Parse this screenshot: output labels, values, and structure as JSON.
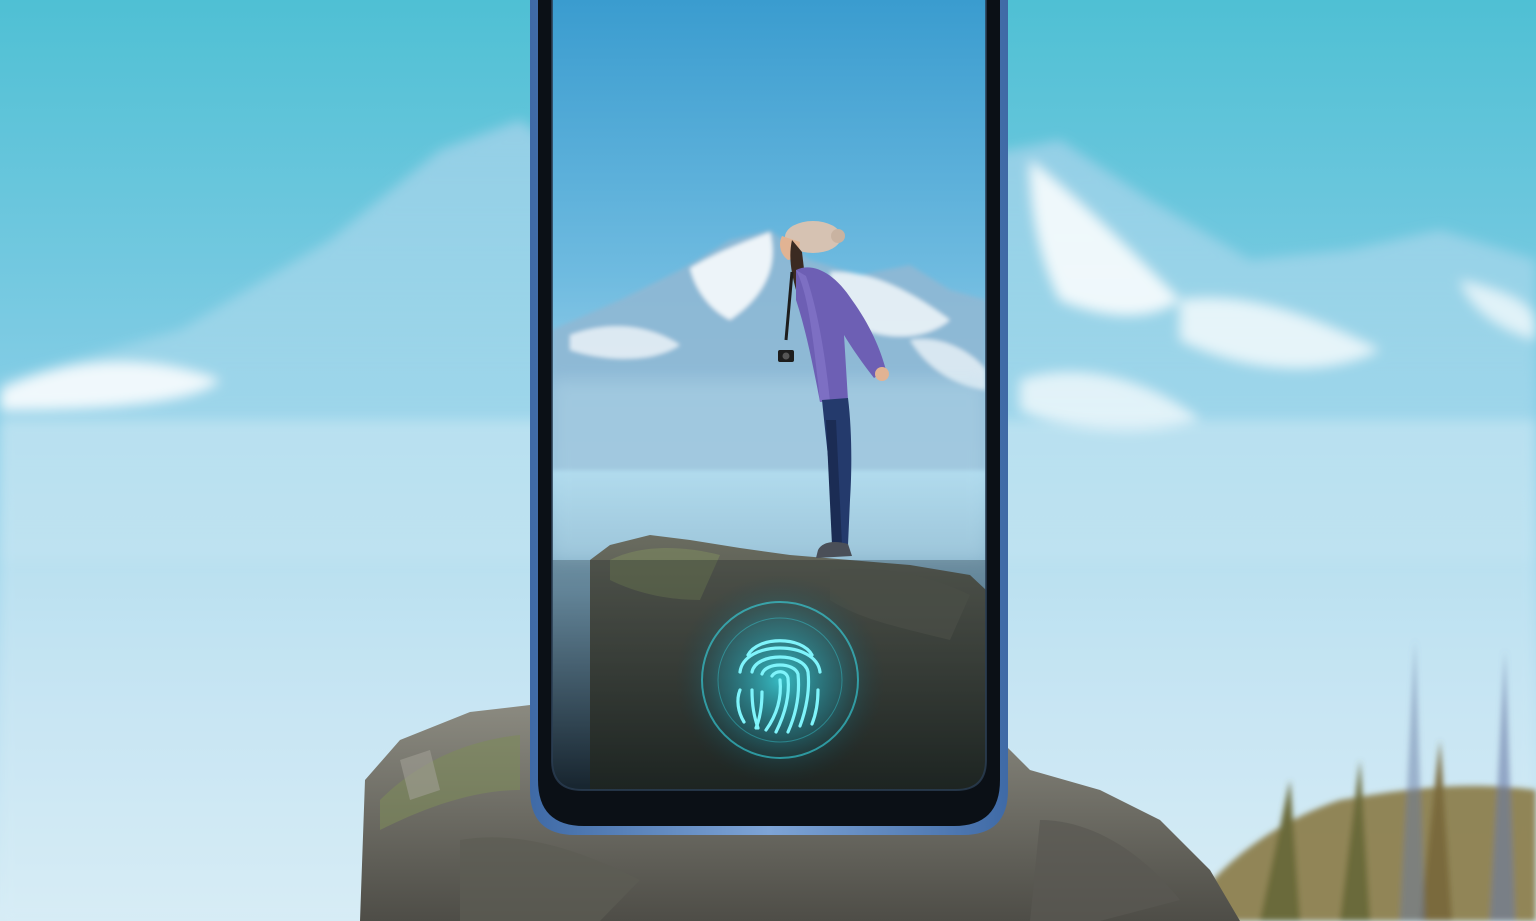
{
  "scene": {
    "sky_top_color": "#56c3d6",
    "sky_mid_color": "#9ad3ea",
    "sky_haze_color": "#cfe8f2",
    "rock_color": "#6f6e66",
    "grass_color": "#8a7a45"
  },
  "phone": {
    "frame_color": "#5a7fb8",
    "bezel_color": "#0b1016",
    "screen_sky_top": "#3b9ed0",
    "screen_sky_bottom": "#bfe3f1"
  },
  "person": {
    "hat_color": "#d6c2b2",
    "jacket_color": "#6d5fb4",
    "pants_color": "#243a6c"
  },
  "fingerprint_sensor": {
    "icon": "fingerprint-icon",
    "glow_color": "#38e6f2"
  }
}
